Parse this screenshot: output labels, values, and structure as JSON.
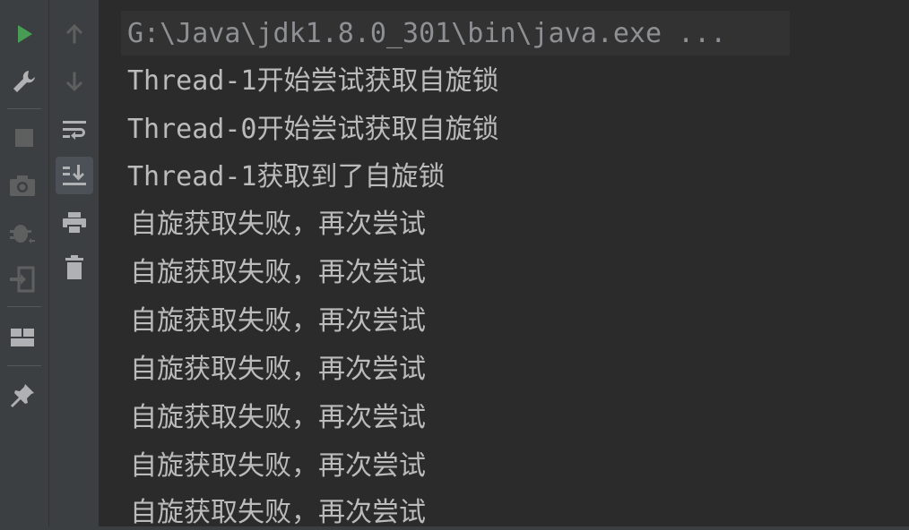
{
  "toolbar_left": {
    "items": [
      {
        "name": "run-icon",
        "color": "#499c54"
      },
      {
        "name": "wrench-icon"
      },
      {
        "name": "stop-icon"
      },
      {
        "name": "camera-icon"
      },
      {
        "name": "debug-bug-icon"
      },
      {
        "name": "exit-icon"
      },
      {
        "name": "layout-icon"
      },
      {
        "name": "pin-icon"
      }
    ]
  },
  "toolbar_mid": {
    "items": [
      {
        "name": "arrow-up-icon"
      },
      {
        "name": "arrow-down-icon"
      },
      {
        "name": "soft-wrap-icon"
      },
      {
        "name": "scroll-to-end-icon",
        "selected": true
      },
      {
        "name": "print-icon"
      },
      {
        "name": "trash-icon"
      }
    ]
  },
  "console": {
    "command": "G:\\Java\\jdk1.8.0_301\\bin\\java.exe ...",
    "lines": [
      "Thread-1开始尝试获取自旋锁",
      "Thread-0开始尝试获取自旋锁",
      "Thread-1获取到了自旋锁",
      "自旋获取失败，再次尝试",
      "自旋获取失败，再次尝试",
      "自旋获取失败，再次尝试",
      "自旋获取失败，再次尝试",
      "自旋获取失败，再次尝试",
      "自旋获取失败，再次尝试",
      "自旋获取失败，再次尝试"
    ]
  },
  "colors": {
    "background": "#2b2b2b",
    "toolbar": "#3c3f41",
    "text": "#bbbbbb",
    "command_text": "#8e9093",
    "run_green": "#499c54"
  }
}
